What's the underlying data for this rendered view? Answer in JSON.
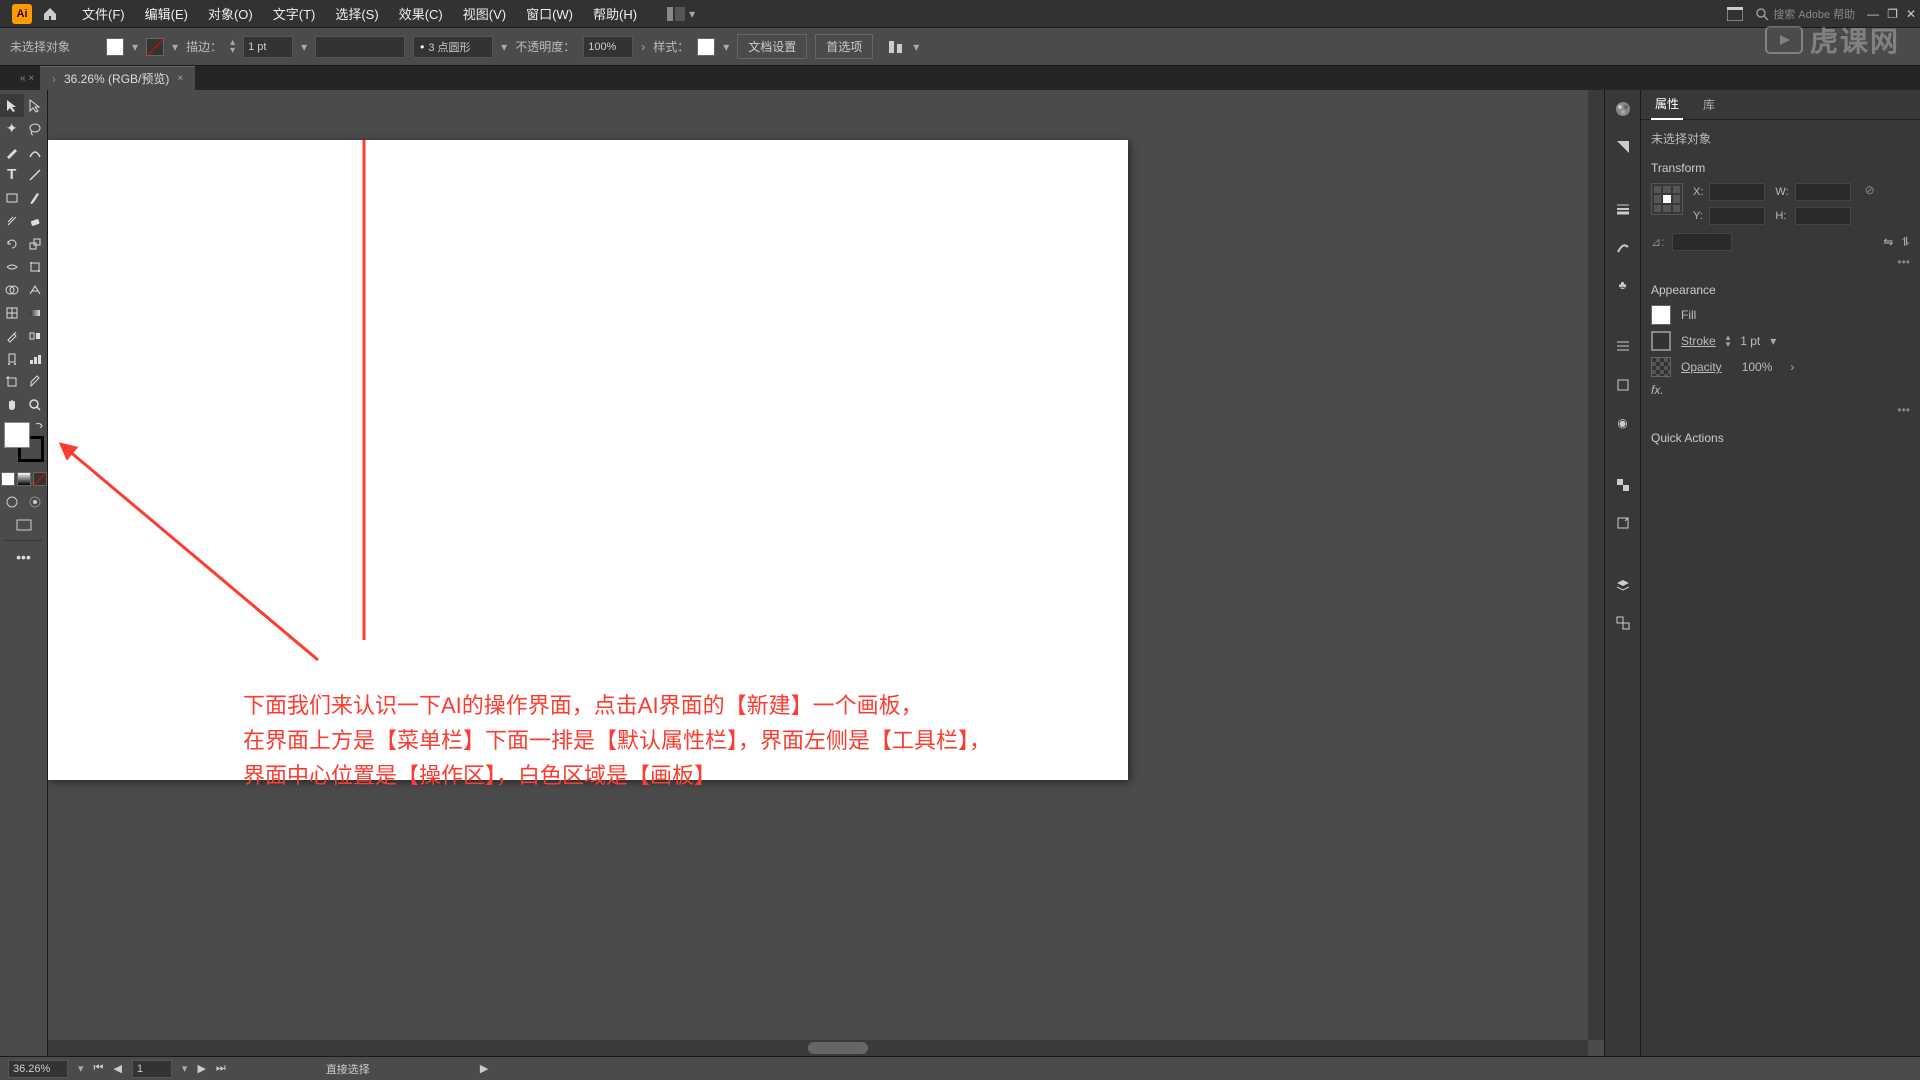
{
  "menu": {
    "file": "文件(F)",
    "edit": "编辑(E)",
    "object": "对象(O)",
    "type": "文字(T)",
    "select": "选择(S)",
    "effect": "效果(C)",
    "view": "视图(V)",
    "window": "窗口(W)",
    "help": "帮助(H)"
  },
  "search_placeholder": "搜索 Adobe 帮助",
  "optbar": {
    "noselect": "未选择对象",
    "stroke_label": "描边：",
    "stroke_value": "1 pt",
    "brush_label": "3 点圆形",
    "opacity_label": "不透明度：",
    "opacity_value": "100%",
    "style_label": "样式：",
    "doc_setup": "文档设置",
    "prefs": "首选项"
  },
  "doc_tab": "36.26% (RGB/预览)",
  "status": {
    "zoom": "36.26%",
    "page": "1",
    "tool": "直接选择"
  },
  "properties": {
    "tab_props": "属性",
    "tab_lib": "库",
    "noselect": "未选择对象",
    "transform": "Transform",
    "x": "X:",
    "y": "Y:",
    "w": "W:",
    "h": "H:",
    "appearance": "Appearance",
    "fill": "Fill",
    "stroke": "Stroke",
    "stroke_val": "1 pt",
    "opacity": "Opacity",
    "opacity_val": "100%",
    "fx": "fx.",
    "quick": "Quick Actions"
  },
  "annotation": {
    "l1": "下面我们来认识一下AI的操作界面，点击AI界面的【新建】一个画板，",
    "l2": "在界面上方是【菜单栏】下面一排是【默认属性栏】，界面左侧是【工具栏】，",
    "l3": "界面中心位置是【操作区】，白色区域是【画板】"
  },
  "watermark": "虎课网"
}
